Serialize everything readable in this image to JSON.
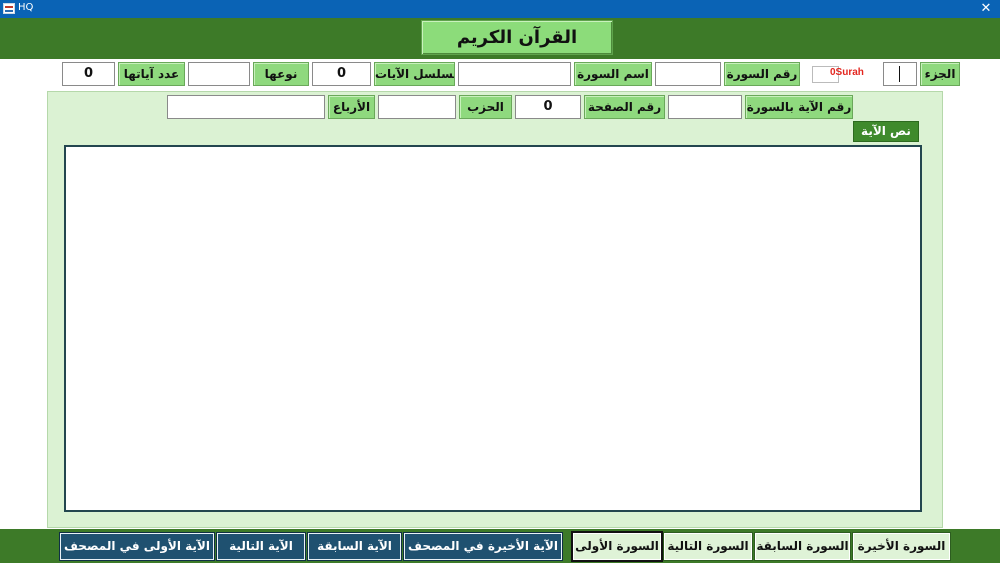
{
  "window": {
    "title": "HQ",
    "close_symbol": "✕"
  },
  "header": {
    "main_title": "القرآن الكريم"
  },
  "row1": {
    "juz_label": "الجزء",
    "juz_value": "",
    "surah_indicator": "0Surah",
    "surah_number_label": "رقم السورة",
    "surah_number_value": "",
    "surah_name_label": "اسم السورة",
    "surah_name_value": "",
    "ayah_sequence_label": "تسلسل الآيات",
    "ayah_sequence_value": "0",
    "type_label": "نوعها",
    "type_value": "",
    "ayah_count_label": "عدد آياتها",
    "ayah_count_value": "0"
  },
  "row2": {
    "ayah_in_surah_label": "رقم الآية بالسورة",
    "ayah_in_surah_value": "",
    "page_number_label": "رقم الصفحة",
    "page_number_value": "0",
    "hizb_label": "الحزب",
    "hizb_value": "",
    "rub_label": "الأرباع",
    "rub_value": ""
  },
  "verse": {
    "label": "نص الآية",
    "text": ""
  },
  "buttons": {
    "last_surah": "السورة الأخيرة",
    "prev_surah": "السورة السابقة",
    "next_surah": "السورة التالية",
    "first_surah": "السورة الأولى",
    "last_ayah_mushaf": "الآية الأخيرة في المصحف",
    "prev_ayah": "الآية السابقة",
    "next_ayah": "الآية التالية",
    "first_ayah_mushaf": "الآية الأولى في المصحف"
  },
  "colors": {
    "header_green": "#3d7a28",
    "label_green": "#8fd97e",
    "panel_green": "#dbf2d3",
    "nav_blue": "#1f5170",
    "surah_red": "#e3261f"
  }
}
